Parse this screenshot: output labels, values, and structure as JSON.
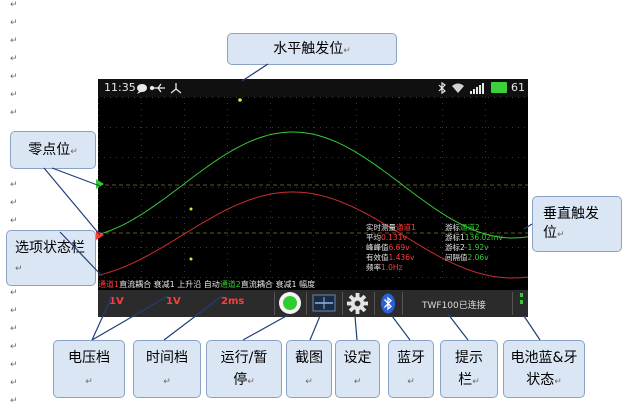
{
  "status_bar": {
    "time": "11:35",
    "battery": "61"
  },
  "scope": {
    "measure_title_label": "实时测量",
    "measure_title_channel": "通道1",
    "left_rows": [
      {
        "label": "平均",
        "value": "0.131v"
      },
      {
        "label": "峰峰值",
        "value": "6.69v"
      },
      {
        "label": "有效值",
        "value": "1.436v"
      },
      {
        "label": "频率",
        "value": "1.0Hz"
      }
    ],
    "right_rows": [
      {
        "label": "游标",
        "value": "通道2"
      },
      {
        "label": "游标1",
        "value": "136.02mv"
      },
      {
        "label": "游标2",
        "value": "-1.92v"
      },
      {
        "label": "间隔值",
        "value": "2.06v"
      }
    ]
  },
  "option_bar": {
    "ch1": "通道1",
    "ch1_settings": "直流耦合 衰减1 上升沿 自动",
    "ch2": "通道2",
    "ch2_settings": "直流耦合 衰减1 幅度"
  },
  "bottom_bar": {
    "voltage1": "1V",
    "voltage2": "1V",
    "timebase": "2ms",
    "hint": "TWF100已连接"
  },
  "callouts": {
    "horizontal_trigger": "水平触发位",
    "zero_point": "零点位",
    "option_status_bar": "选项状态栏",
    "vertical_trigger": "垂直触发位",
    "voltage": "电压档",
    "time": "时间档",
    "run_pause": "运行/暂停",
    "screenshot": "截图",
    "settings": "设定",
    "bluetooth": "蓝牙",
    "hint_bar": "提示栏",
    "battery_bt": "电池蓝&牙状态"
  },
  "colors": {
    "ch1": "#ff3b3b",
    "ch2": "#36c936",
    "callout_fill": "#dbe6f4",
    "callout_border": "#8aa3c5"
  }
}
